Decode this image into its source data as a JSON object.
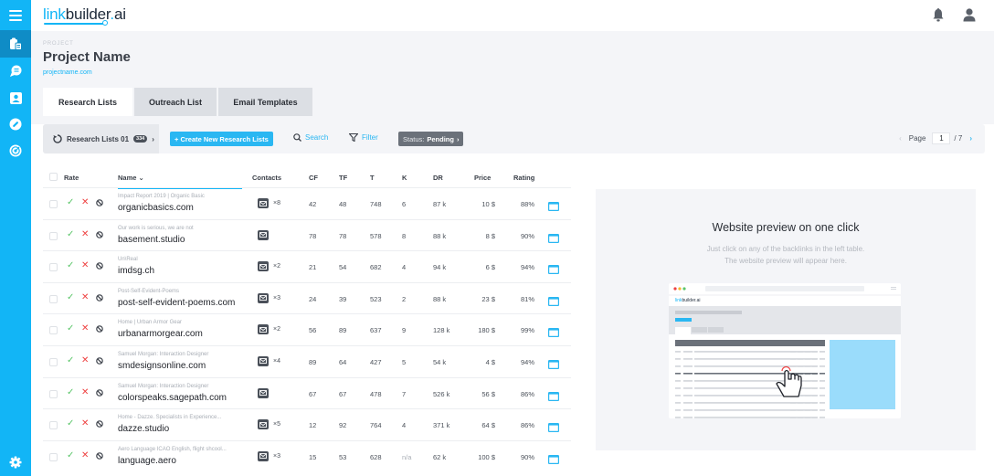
{
  "app": {
    "logo": {
      "link": "link",
      "builder": "builder",
      "dot": ".",
      "ai": "ai"
    },
    "sidebar": {
      "items": [
        {
          "name": "menu",
          "icon": "hamburger-menu-icon"
        },
        {
          "name": "research",
          "icon": "clipboard-list-icon",
          "active": true
        },
        {
          "name": "outreach",
          "icon": "chat-bubble-icon"
        },
        {
          "name": "contacts",
          "icon": "contact-card-icon"
        },
        {
          "name": "links",
          "icon": "link-icon"
        },
        {
          "name": "targets",
          "icon": "radar-target-icon"
        },
        {
          "name": "settings",
          "icon": "gear-icon"
        }
      ]
    },
    "topbar": {
      "icons": [
        "bell-icon",
        "user-icon"
      ]
    }
  },
  "header": {
    "eyebrow": "PROJECT",
    "title": "Project Name",
    "chevron": "›",
    "url": "projectname.com",
    "tabs": [
      {
        "label": "Research Lists",
        "active": true
      },
      {
        "label": "Outreach List",
        "active": false
      },
      {
        "label": "Email Templates",
        "active": false
      }
    ]
  },
  "toolbar": {
    "list_select": {
      "label": "Research Lists 01",
      "badge": "334",
      "chevron": "›"
    },
    "create_button": "+ Create New Research Lists",
    "search_label": "Search",
    "filter_label": "Filter",
    "status": {
      "prefix": "Status:",
      "value": "Pending",
      "chevron": "›"
    },
    "pager": {
      "prev": "‹",
      "label": "Page",
      "current": "1",
      "total": "/ 7",
      "next": "›"
    }
  },
  "table": {
    "columns": [
      "Rate",
      "Name",
      "Contacts",
      "CF",
      "TF",
      "T",
      "K",
      "DR",
      "Price",
      "Rating"
    ],
    "name_sort_indicator": "⌄",
    "rows": [
      {
        "snippet": "Impact Report 2019 | Organic Basic",
        "domain": "organicbasics.com",
        "contacts": "×8",
        "cf": "42",
        "tf": "48",
        "t": "748",
        "k": "6",
        "dr": "87 k",
        "price": "10 $",
        "rating": "88%"
      },
      {
        "snippet": "Our work is serious, we are not",
        "domain": "basement.studio",
        "contacts": "",
        "cf": "78",
        "tf": "78",
        "t": "578",
        "k": "8",
        "dr": "88 k",
        "price": "8 $",
        "rating": "90%"
      },
      {
        "snippet": "Un\\Real",
        "domain": "imdsg.ch",
        "contacts": "×2",
        "cf": "21",
        "tf": "54",
        "t": "682",
        "k": "4",
        "dr": "94 k",
        "price": "6 $",
        "rating": "94%"
      },
      {
        "snippet": "Post-Self-Evident-Poems",
        "domain": "post-self-evident-poems.com",
        "contacts": "×3",
        "cf": "24",
        "tf": "39",
        "t": "523",
        "k": "2",
        "dr": "88 k",
        "price": "23 $",
        "rating": "81%"
      },
      {
        "snippet": "Home | Urban Armor Gear",
        "domain": "urbanarmorgear.com",
        "contacts": "×2",
        "cf": "56",
        "tf": "89",
        "t": "637",
        "k": "9",
        "dr": "128 k",
        "price": "180 $",
        "rating": "99%"
      },
      {
        "snippet": "Samuel Morgan: Interaction Designer",
        "domain": "smdesignsonline.com",
        "contacts": "×4",
        "cf": "89",
        "tf": "64",
        "t": "427",
        "k": "5",
        "dr": "54 k",
        "price": "4 $",
        "rating": "94%"
      },
      {
        "snippet": "Samuel Morgan: Interaction Designer",
        "domain": "colorspeaks.sagepath.com",
        "contacts": "",
        "cf": "67",
        "tf": "67",
        "t": "478",
        "k": "7",
        "dr": "526 k",
        "price": "56 $",
        "rating": "86%"
      },
      {
        "snippet": "Home - Dazze. Specialists in Experience...",
        "domain": "dazze.studio",
        "contacts": "×5",
        "cf": "12",
        "tf": "92",
        "t": "764",
        "k": "4",
        "dr": "371 k",
        "price": "64 $",
        "rating": "86%"
      },
      {
        "snippet": "Aero Language ICAO English, flight shcool...",
        "domain": "language.aero",
        "contacts": "×3",
        "cf": "15",
        "tf": "53",
        "t": "628",
        "k": "n/a",
        "dr": "62 k",
        "price": "100 $",
        "rating": "90%"
      }
    ]
  },
  "preview": {
    "title": "Website preview on one click",
    "line1": "Just click on any of the backlinks in the left table.",
    "line2": "The website preview will appear here.",
    "mock_logo": {
      "link": "link",
      "rest": "builder.ai"
    }
  },
  "colors": {
    "brand": "#12b5f6",
    "sidebar_active": "#0f8cc6",
    "approve": "#5cc66a",
    "reject": "#ee4141",
    "status_chip": "#6b717a"
  }
}
